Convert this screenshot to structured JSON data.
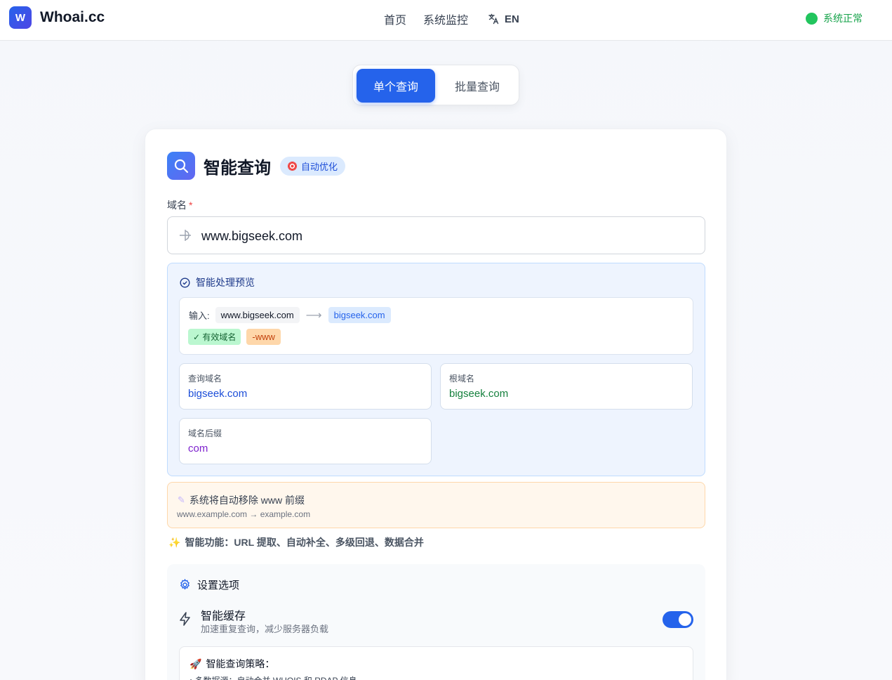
{
  "header": {
    "logo_letter": "W",
    "brand": "Whoai.cc",
    "nav": {
      "home": "首页",
      "monitor": "系统监控",
      "lang": "EN"
    },
    "status": "系统正常"
  },
  "tabs": {
    "single": "单个查询",
    "batch": "批量查询"
  },
  "card": {
    "title": "智能查询",
    "badge": "自动优化",
    "field_label": "域名",
    "required_mark": "*",
    "domain_value": "www.bigseek.com",
    "preview": {
      "title": "智能处理预览",
      "input_label": "输入:",
      "input_value": "www.bigseek.com",
      "output_value": "bigseek.com",
      "tag_valid": "✓ 有效域名",
      "tag_www": "-www",
      "query_domain_label": "查询域名",
      "query_domain_value": "bigseek.com",
      "root_domain_label": "根域名",
      "root_domain_value": "bigseek.com",
      "suffix_label": "域名后缀",
      "suffix_value": "com"
    },
    "notice": {
      "line1": "系统将自动移除 www 前缀",
      "line2": "www.example.com → example.com"
    },
    "features": "智能功能：URL 提取、自动补全、多级回退、数据合并",
    "settings": {
      "title": "设置选项",
      "cache_title": "智能缓存",
      "cache_desc": "加速重复查询，减少服务器负载",
      "cache_enabled": true,
      "strategy_title": "智能查询策略：",
      "strategy_item": "• 多数据源：自动合并 WHOIS 和 RDAP 信息"
    }
  },
  "colors": {
    "accent": "#2563eb",
    "status_green": "#22c55e"
  }
}
